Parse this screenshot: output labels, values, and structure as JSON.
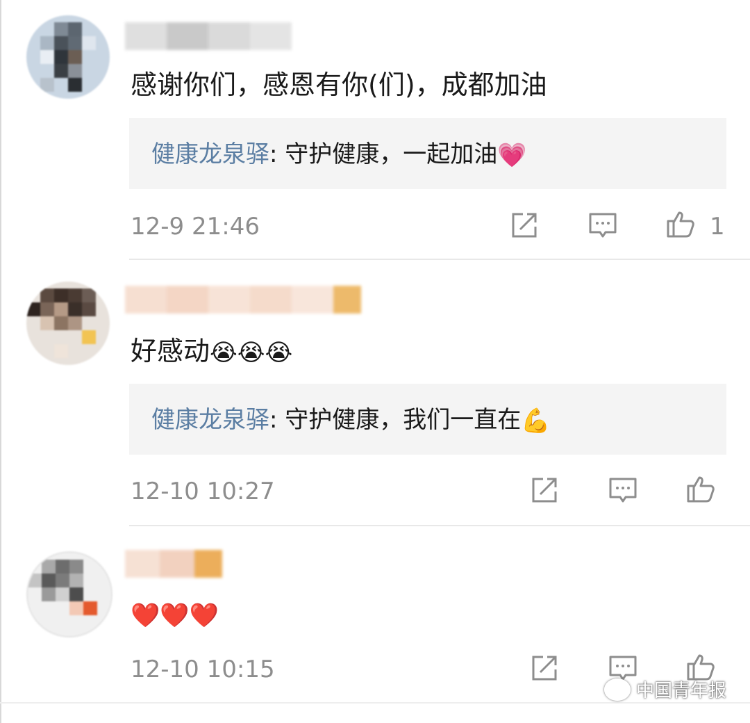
{
  "comments": [
    {
      "text": "感谢你们，感恩有你(们)，成都加油",
      "emoji": "",
      "reply": {
        "author": "健康龙泉驿",
        "separator": ": ",
        "text": "守护健康，一起加油",
        "emoji": "💗"
      },
      "timestamp": "12-9 21:46",
      "like_count": "1"
    },
    {
      "text": "好感动",
      "emoji": "😭😭😭",
      "reply": {
        "author": "健康龙泉驿",
        "separator": ": ",
        "text": "守护健康，我们一直在",
        "emoji": "💪"
      },
      "timestamp": "12-10 10:27",
      "like_count": ""
    },
    {
      "text": "",
      "emoji": "❤️❤️❤️",
      "timestamp": "12-10 10:15",
      "like_count": ""
    }
  ],
  "watermark": {
    "text": "中国青年报"
  },
  "icons": {
    "share": "share-icon",
    "comment": "comment-icon",
    "like": "thumbs-up-icon"
  }
}
